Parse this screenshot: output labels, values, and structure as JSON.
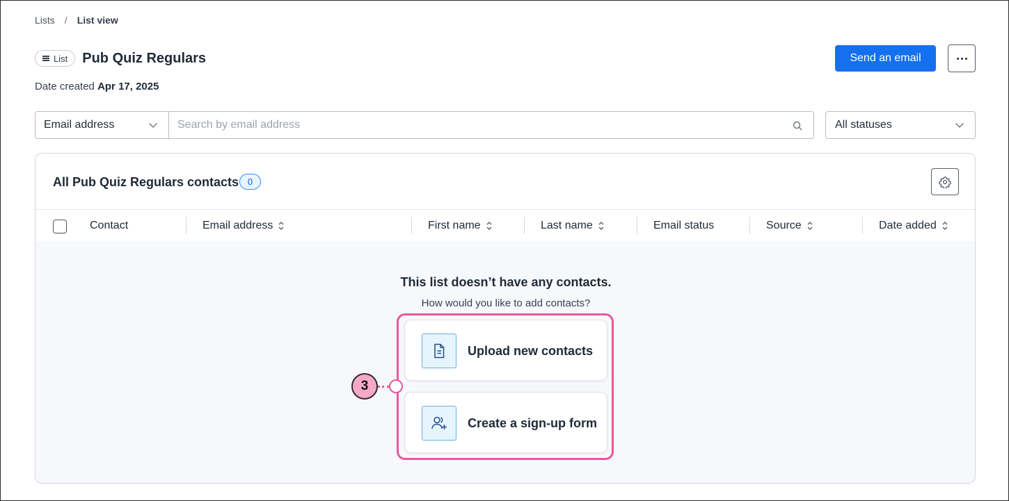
{
  "breadcrumb": {
    "root": "Lists",
    "separator": "/",
    "current": "List view"
  },
  "header": {
    "badge": "List",
    "title": "Pub Quiz Regulars",
    "date_label": "Date created",
    "date_value": "Apr 17, 2025",
    "send_button": "Send an email",
    "more_icon": "ellipsis-icon"
  },
  "filters": {
    "field_select": "Email address",
    "search_placeholder": "Search by email address",
    "status_select": "All statuses"
  },
  "contacts_card": {
    "title": "All Pub Quiz Regulars contacts",
    "count": "0",
    "settings_icon": "gear-icon",
    "columns": [
      {
        "label": "Contact",
        "sortable": false
      },
      {
        "label": "Email address",
        "sortable": true
      },
      {
        "label": "First name",
        "sortable": true
      },
      {
        "label": "Last name",
        "sortable": true
      },
      {
        "label": "Email status",
        "sortable": false
      },
      {
        "label": "Source",
        "sortable": true
      },
      {
        "label": "Date added",
        "sortable": true
      }
    ],
    "empty_title": "This list doesn’t have any contacts.",
    "empty_subtitle": "How would you like to add contacts?",
    "options": [
      {
        "label": "Upload new contacts",
        "icon": "document-icon"
      },
      {
        "label": "Create a sign-up form",
        "icon": "add-user-icon"
      }
    ]
  },
  "callout": {
    "number": "3"
  },
  "colors": {
    "primary": "#1570ef",
    "highlight": "#e8579d",
    "callout_fill": "#f7a8c9",
    "count_pill": "#2e90fa"
  }
}
